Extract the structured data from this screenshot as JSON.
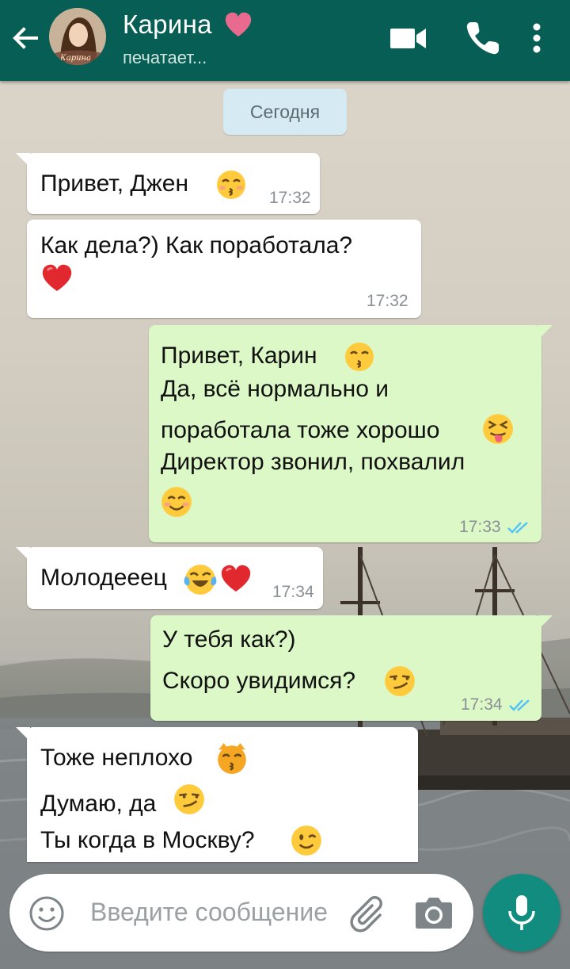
{
  "header": {
    "contact_name": "Карина",
    "status": "печатает...",
    "avatar_caption": "Карина"
  },
  "chat": {
    "date_label": "Сегодня",
    "messages": [
      {
        "direction": "in",
        "lines": [
          "Привет, Джен"
        ],
        "emojis": [
          "kissing-face-smiling-eyes"
        ],
        "time": "17:32"
      },
      {
        "direction": "in",
        "lines": [
          "Как дела?) Как поработала?"
        ],
        "emojis": [
          "red-heart"
        ],
        "time": "17:32"
      },
      {
        "direction": "out",
        "lines": [
          "Привет, Карин",
          "Да, всё нормально и",
          "поработала тоже хорошо",
          "Директор звонил, похвалил"
        ],
        "emojis": [
          "kissing-face-smiling-eyes",
          "squinting-tongue-face",
          "smiling-face-blush"
        ],
        "time": "17:33",
        "read": true
      },
      {
        "direction": "in",
        "lines": [
          "Молодееец"
        ],
        "emojis": [
          "tears-of-joy",
          "red-heart"
        ],
        "time": "17:34"
      },
      {
        "direction": "out",
        "lines": [
          "У тебя как?)",
          "Скоро увидимся?"
        ],
        "emojis": [
          "smirking-face"
        ],
        "time": "17:34",
        "read": true
      },
      {
        "direction": "in",
        "lines": [
          "Тоже неплохо",
          "Думаю, да",
          "Ты когда в Москву?"
        ],
        "emojis": [
          "kissing-cat",
          "smirking-face",
          "winking-face"
        ]
      }
    ]
  },
  "composer": {
    "placeholder": "Введите сообщение"
  },
  "icons": {
    "back": "arrow-left-icon",
    "video": "video-camera-icon",
    "call": "phone-icon",
    "menu": "more-vert-icon",
    "emoji": "emoji-icon",
    "attach": "paperclip-icon",
    "camera": "camera-icon",
    "mic": "microphone-icon",
    "read_ticks": "double-check-icon"
  },
  "colors": {
    "header": "#075e54",
    "bubble_out": "#dcf8c6",
    "bubble_in": "#ffffff",
    "accent": "#128c7e",
    "read_ticks": "#4fc3f7",
    "date_chip": "#d5eaf3"
  }
}
